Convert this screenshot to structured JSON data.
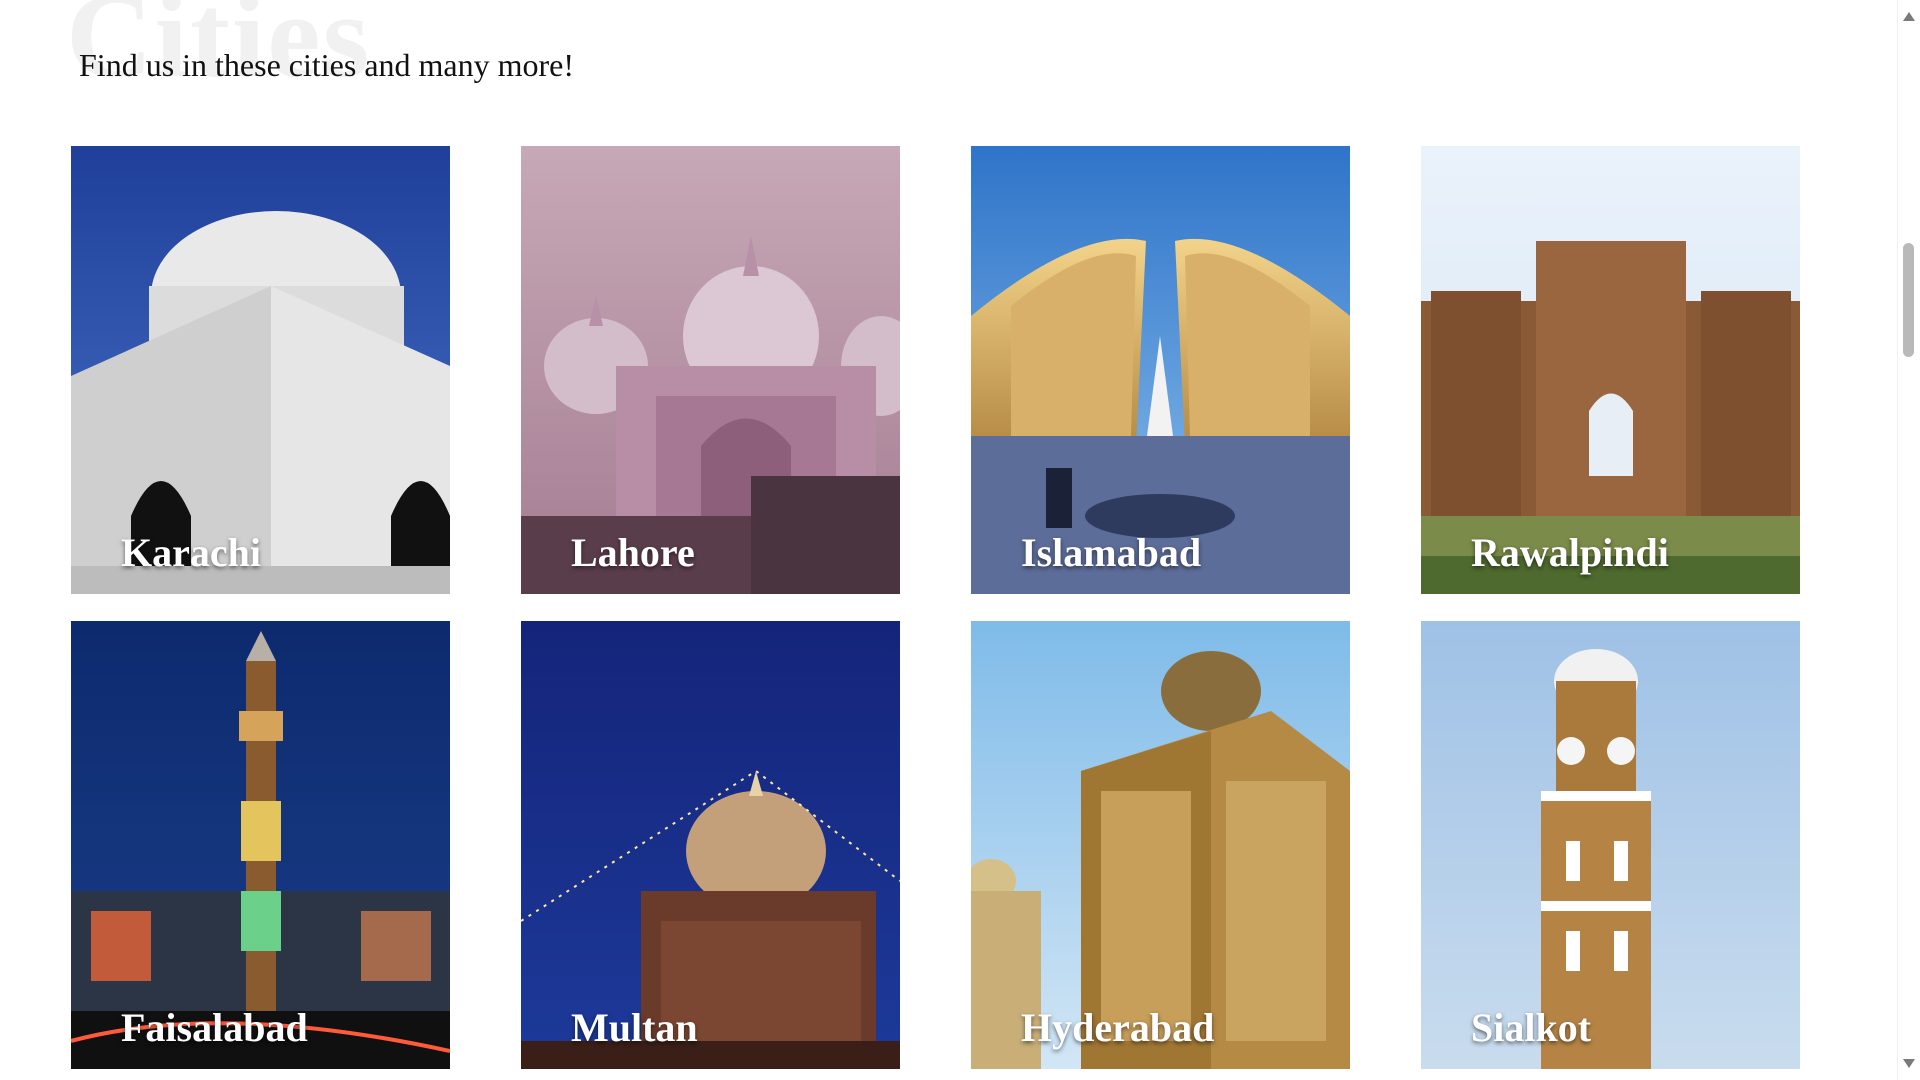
{
  "section": {
    "heading": "Cities",
    "subtitle": "Find us in these cities and many more!"
  },
  "cities": [
    {
      "name": "Karachi"
    },
    {
      "name": "Lahore"
    },
    {
      "name": "Islamabad"
    },
    {
      "name": "Rawalpindi"
    },
    {
      "name": "Faisalabad"
    },
    {
      "name": "Multan"
    },
    {
      "name": "Hyderabad"
    },
    {
      "name": "Sialkot"
    }
  ],
  "icons": {
    "scroll_up": "arrow-up-icon",
    "scroll_down": "arrow-down-icon"
  }
}
